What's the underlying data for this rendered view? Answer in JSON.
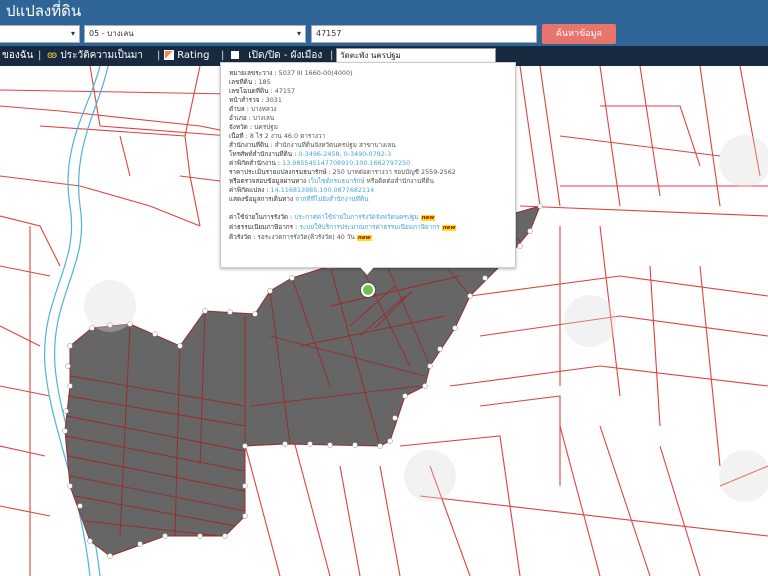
{
  "header": {
    "title": "ปแปลงที่ดิน"
  },
  "filters": {
    "province_value": "",
    "district_value": "05 - บางเลน",
    "parcel_value": "47157",
    "search_label": "ค้นหาข้อมูล"
  },
  "toolbar": {
    "item1": "ของฉัน",
    "item2": "ประวัติความเป็นมา",
    "item3": "Rating",
    "item4": "เปิด/ปิด - ผังเมือง",
    "place_value": "วัดตะพัง นครปฐม"
  },
  "popup": {
    "rows": [
      {
        "label": "หมายเลขระวาง :",
        "value": "5037 III 1660-00(4000)"
      },
      {
        "label": "เลขที่ดิน :",
        "value": "185"
      },
      {
        "label": "เลขโฉนดที่ดิน :",
        "value": "47157"
      },
      {
        "label": "หน้าสำรวจ :",
        "value": "3031"
      },
      {
        "label": "ตำบล :",
        "value": "บางหลวง"
      },
      {
        "label": "อำเภอ :",
        "value": "บางเลน"
      },
      {
        "label": "จังหวัด :",
        "value": "นครปฐม"
      },
      {
        "label": "เนื้อที่ :",
        "value": "8 ไร่ 2 งาน 46.0 ตารางวา"
      }
    ],
    "office_label": "สำนักงานที่ดิน :",
    "office_value": "สำนักงานที่ดินจังหวัดนครปฐม สาขาบางเลน",
    "phone_label": "โทรศัพท์สำนักงานที่ดิน :",
    "phone_value": "0-3496-2458, 0-3490-0792-3",
    "coord_office_label": "ค่าพิกัดสำนักงาน :",
    "coord_office_value": "13.985545147708910,100.1662797250",
    "price_label": "ราคาประเมินรายแปลงกรมธนารักษ์ :",
    "price_value": "250 บาทต่อตารางวา รอบบัญชี 2559-2562",
    "check_label": "หรือตรวจสอบข้อมูลผ่านทาง",
    "check_link": "เว็บไซต์กรมธนารักษ์",
    "check_tail": "หรือติดต่อสำนักงานที่ดิน",
    "coord_parcel_label": "ค่าพิกัดแปลง :",
    "coord_parcel_value": "14.116813985,100.0877682114",
    "route_label": "แสดงข้อมูลการเดินทาง",
    "route_link": "จากที่ที่ไปยังสำนักงานที่ดิน",
    "s1_label": "ค่าใช้จ่ายในการรังวัด :",
    "s1_link": "ประกาศค่าใช้จ่ายในการรังวัดจังหวัดนครปฐม",
    "s2_label": "ค่าธรรมเนียมภาษีอากร :",
    "s2_link": "ระบบให้บริการประมาณการค่าธรรมเนียมภาษีอากร",
    "s3_label": "คิวรังวัด :",
    "s3_value": "รอระงวดการรังวัด(คิวรังวัด) 40 วัน",
    "new_badge": "new"
  },
  "map": {
    "parcel_fill": "#666666",
    "parcel_line": "#9b2a2a",
    "road_line": "#e0433f",
    "river_line": "#4fb3d9",
    "vertex_fill": "#ffffff"
  }
}
